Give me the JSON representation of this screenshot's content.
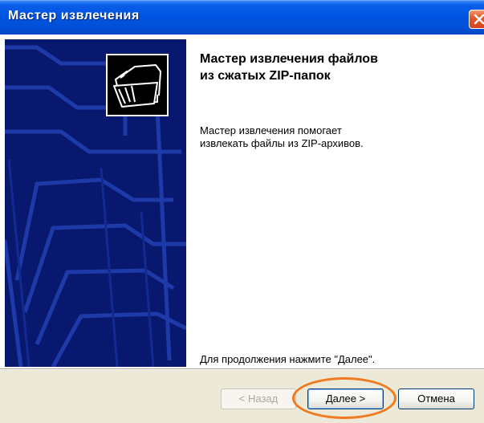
{
  "window": {
    "title": "Мастер извлечения"
  },
  "icons": {
    "close": "close-icon",
    "logo": "compressed-folders-icon"
  },
  "main": {
    "heading_line1": "Мастер извлечения файлов",
    "heading_line2": "из сжатых ZIP-папок",
    "description_line1": "Мастер извлечения помогает",
    "description_line2": "извлекать файлы из ZIP-архивов.",
    "continue_hint": "Для продолжения нажмите \"Далее\"."
  },
  "buttons": {
    "back_label": "< Назад",
    "back_enabled": false,
    "next_label": "Далее >",
    "cancel_label": "Отмена"
  },
  "colors": {
    "titlebar": "#0054e3",
    "side_panel": "#0a1a7a",
    "highlight": "#f07a1e"
  }
}
